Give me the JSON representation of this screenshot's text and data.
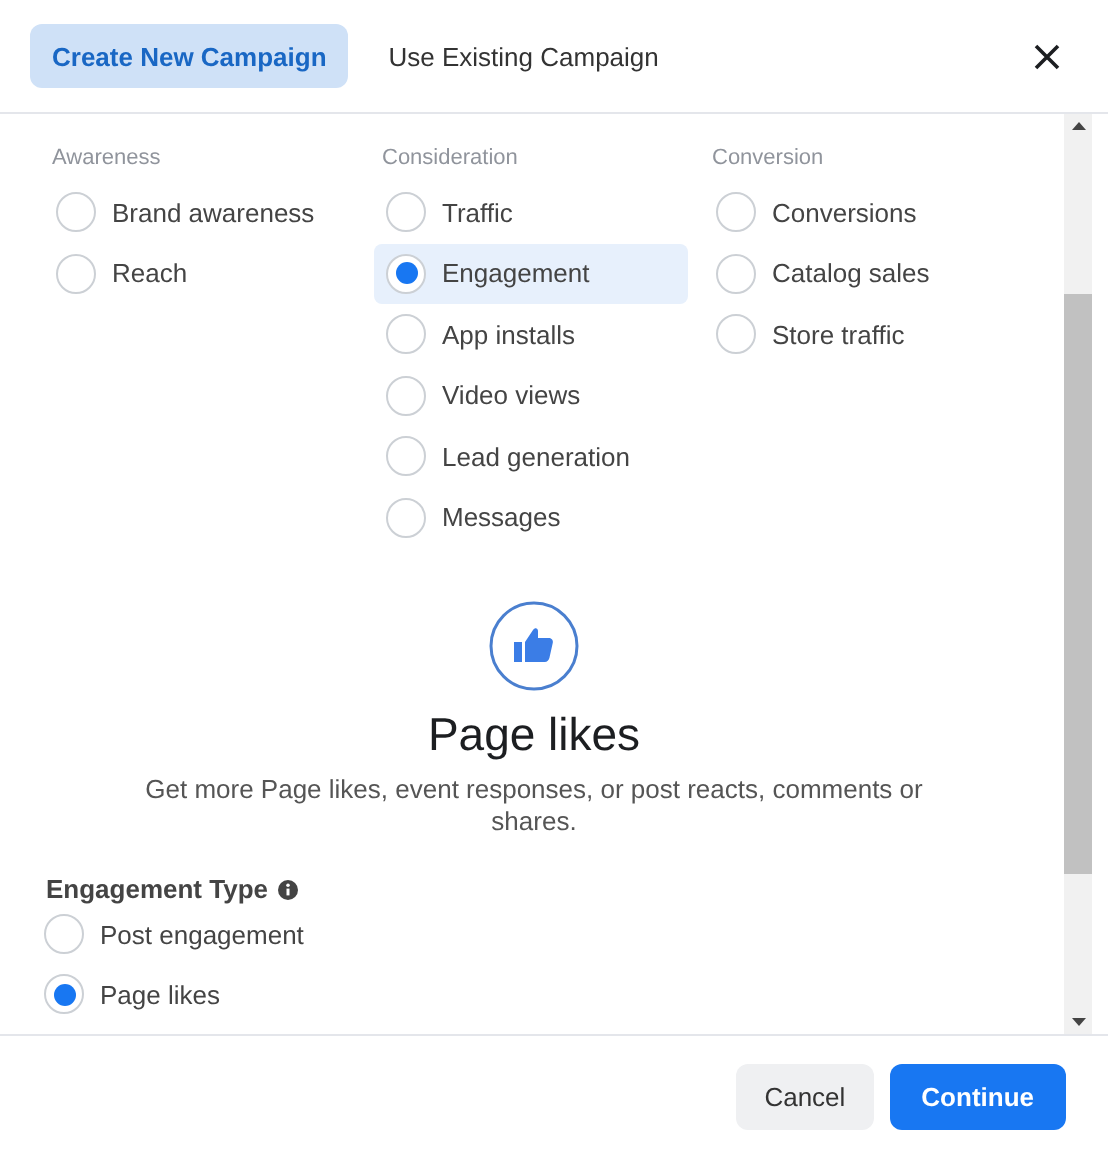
{
  "tabs": [
    {
      "label": "Create New Campaign",
      "selected": true
    },
    {
      "label": "Use Existing Campaign",
      "selected": false
    }
  ],
  "objective_groups": [
    {
      "heading": "Awareness",
      "options": [
        {
          "label": "Brand awareness",
          "selected": false
        },
        {
          "label": "Reach",
          "selected": false
        }
      ]
    },
    {
      "heading": "Consideration",
      "options": [
        {
          "label": "Traffic",
          "selected": false
        },
        {
          "label": "Engagement",
          "selected": true
        },
        {
          "label": "App installs",
          "selected": false
        },
        {
          "label": "Video views",
          "selected": false
        },
        {
          "label": "Lead generation",
          "selected": false
        },
        {
          "label": "Messages",
          "selected": false
        }
      ]
    },
    {
      "heading": "Conversion",
      "options": [
        {
          "label": "Conversions",
          "selected": false
        },
        {
          "label": "Catalog sales",
          "selected": false
        },
        {
          "label": "Store traffic",
          "selected": false
        }
      ]
    }
  ],
  "detail": {
    "title": "Page likes",
    "description": "Get more Page likes, event responses, or post reacts, comments or shares."
  },
  "engagement_type": {
    "label": "Engagement Type",
    "options": [
      {
        "label": "Post engagement",
        "selected": false
      },
      {
        "label": "Page likes",
        "selected": true
      }
    ]
  },
  "buttons": [
    {
      "label": "Cancel",
      "kind": "secondary"
    },
    {
      "label": "Continue",
      "kind": "primary"
    }
  ]
}
